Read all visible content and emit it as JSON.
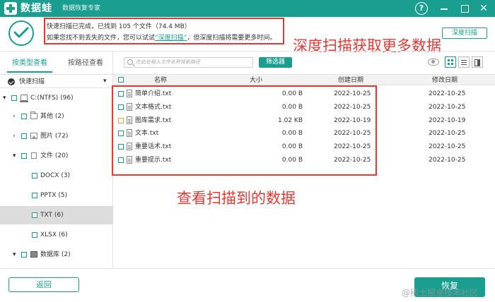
{
  "titlebar": {
    "app_name": "数据蛙",
    "app_subtitle": "数据恢复专家",
    "help_label": "?",
    "close_label": "✕"
  },
  "status": {
    "line1": "快速扫描已完成，已找到 105 个文件（74.4 MB）",
    "line2_prefix": "如果您找不到丢失的文件，您可以试试",
    "line2_link": "“深度扫描”",
    "line2_suffix": "，但深度扫描将需要更多时间。",
    "deep_scan_button": "深度扫描"
  },
  "annotations": {
    "top": "深度扫描获取更多数据",
    "middle": "查看扫描到的数据"
  },
  "sidebar": {
    "tab_by_type": "按类型查看",
    "tab_by_path": "按路径查看",
    "scan_mode": "快速扫描",
    "tree": [
      {
        "label": "C:(NTFS) (96)",
        "arrow": "▾",
        "icon": "drive-icon"
      },
      {
        "label": "其他 (2)",
        "arrow": "›",
        "icon": "folder-icon"
      },
      {
        "label": "图片 (72)",
        "arrow": "›",
        "icon": "image-icon"
      },
      {
        "label": "文件 (20)",
        "arrow": "▾",
        "icon": "document-icon"
      },
      {
        "label": "DOCX (3)",
        "arrow": "",
        "icon": ""
      },
      {
        "label": "PPTX (5)",
        "arrow": "",
        "icon": ""
      },
      {
        "label": "TXT (6)",
        "arrow": "",
        "icon": "",
        "selected": true
      },
      {
        "label": "XLSX (6)",
        "arrow": "",
        "icon": ""
      },
      {
        "label": "数据库 (2)",
        "arrow": "▾",
        "icon": "database-icon"
      }
    ]
  },
  "toolbar": {
    "search_placeholder": "在此处输入文件名称搜索路径",
    "filter_label": "筛选器"
  },
  "table": {
    "headers": {
      "name": "名称",
      "size": "大小",
      "created": "创建日期",
      "modified": "修改日期"
    },
    "rows": [
      {
        "name": "简单介绍.txt",
        "size": "0.00  B",
        "created": "2022-10-25",
        "modified": "2022-10-25",
        "checkbox_color": "#1a9e8f"
      },
      {
        "name": "文本格式.txt",
        "size": "0.00  B",
        "created": "2022-10-25",
        "modified": "2022-10-25",
        "checkbox_color": "#1a9e8f"
      },
      {
        "name": "图库需求.txt",
        "size": "1.02 KB",
        "created": "2022-10-19",
        "modified": "2022-10-19",
        "checkbox_color": "#f0a030"
      },
      {
        "name": "文本.txt",
        "size": "0.00  B",
        "created": "2022-10-25",
        "modified": "2022-10-25",
        "checkbox_color": "#1a9e8f"
      },
      {
        "name": "重要话术.txt",
        "size": "0.00  B",
        "created": "2022-10-25",
        "modified": "2022-10-25",
        "checkbox_color": "#1a9e8f"
      },
      {
        "name": "重要提示.txt",
        "size": "0.00  B",
        "created": "2022-10-25",
        "modified": "2022-10-25",
        "checkbox_color": "#1a9e8f"
      }
    ]
  },
  "footer": {
    "back_label": "返回",
    "recover_label": "恢复",
    "watermark": "@稀土掘金技术社区"
  },
  "colors": {
    "accent": "#1a9e8f",
    "annotation_red": "#e53935",
    "warning_orange": "#f0a030"
  }
}
